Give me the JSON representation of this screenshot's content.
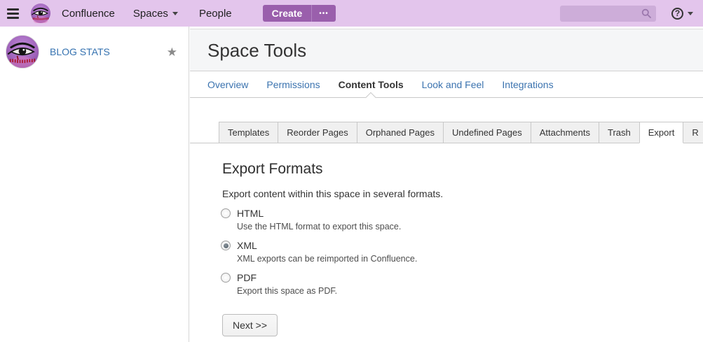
{
  "topbar": {
    "brand": "Confluence",
    "menu_spaces": "Spaces",
    "menu_people": "People",
    "create_button": "Create",
    "more_label": "•••",
    "search_placeholder": "",
    "colors": {
      "bar_bg": "#e3c5ec",
      "button_bg": "#9a5fac"
    }
  },
  "sidebar": {
    "space_name": "BLOG STATS"
  },
  "space_header": {
    "title": "Space Tools"
  },
  "nav_tabs": {
    "items": [
      {
        "label": "Overview",
        "active": false
      },
      {
        "label": "Permissions",
        "active": false
      },
      {
        "label": "Content Tools",
        "active": true
      },
      {
        "label": "Look and Feel",
        "active": false
      },
      {
        "label": "Integrations",
        "active": false
      }
    ],
    "link_color": "#3b73af"
  },
  "sub_tabs": {
    "items": [
      {
        "label": "Templates",
        "active": false
      },
      {
        "label": "Reorder Pages",
        "active": false
      },
      {
        "label": "Orphaned Pages",
        "active": false
      },
      {
        "label": "Undefined Pages",
        "active": false
      },
      {
        "label": "Attachments",
        "active": false
      },
      {
        "label": "Trash",
        "active": false
      },
      {
        "label": "Export",
        "active": true
      },
      {
        "label": "R",
        "active": false,
        "truncated": true
      }
    ]
  },
  "export_panel": {
    "heading": "Export Formats",
    "intro": "Export content within this space in several formats.",
    "options": [
      {
        "label": "HTML",
        "description": "Use the HTML format to export this space.",
        "selected": false
      },
      {
        "label": "XML",
        "description": "XML exports can be reimported in Confluence.",
        "selected": true
      },
      {
        "label": "PDF",
        "description": "Export this space as PDF.",
        "selected": false
      }
    ],
    "next_button": "Next >>"
  }
}
